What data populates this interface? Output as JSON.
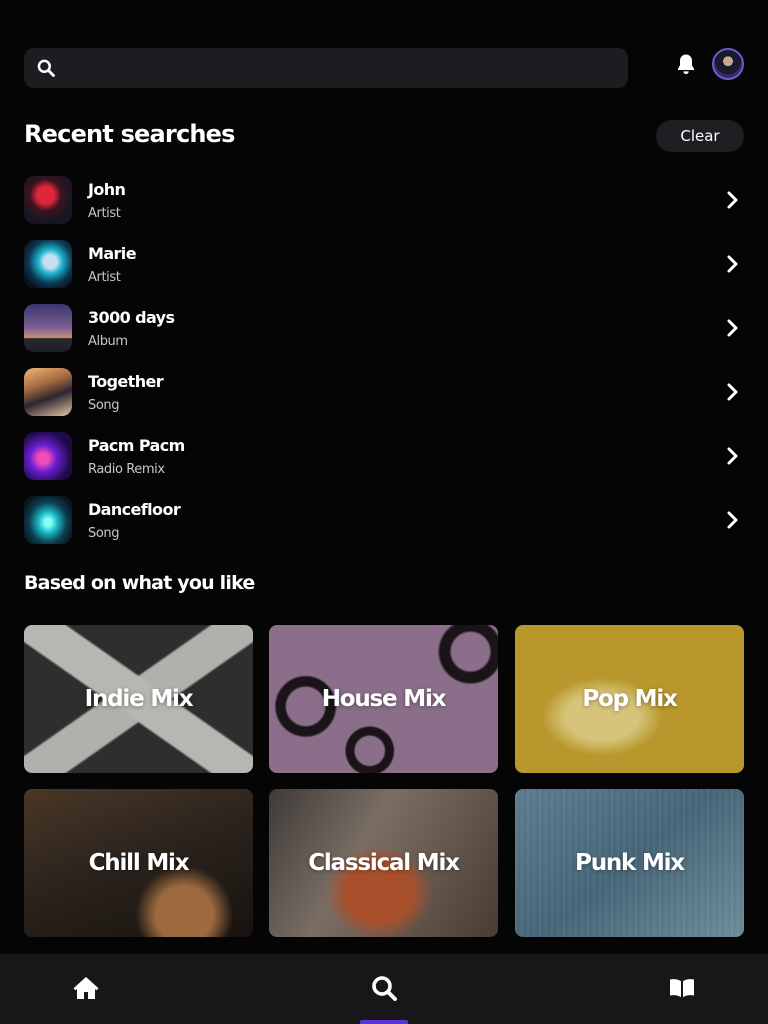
{
  "header": {
    "search_placeholder": "",
    "search_value": ""
  },
  "recent": {
    "title": "Recent searches",
    "clear_label": "Clear",
    "items": [
      {
        "name": "John",
        "type": "Artist"
      },
      {
        "name": "Marie",
        "type": "Artist"
      },
      {
        "name": "3000 days",
        "type": "Album"
      },
      {
        "name": "Together",
        "type": "Song"
      },
      {
        "name": "Pacm Pacm",
        "type": "Radio Remix"
      },
      {
        "name": "Dancefloor",
        "type": "Song"
      }
    ]
  },
  "suggestions": {
    "title": "Based on what you like",
    "mixes": [
      {
        "label": "Indie Mix"
      },
      {
        "label": "House Mix"
      },
      {
        "label": "Pop Mix"
      },
      {
        "label": "Chill Mix"
      },
      {
        "label": "Classical Mix"
      },
      {
        "label": "Punk Mix"
      }
    ]
  },
  "nav": {
    "items": [
      "home-icon",
      "search-icon",
      "library-icon"
    ],
    "active": "search"
  },
  "colors": {
    "background": "#050506",
    "surface": "#1d1d21",
    "accent": "#5b33d6",
    "text_secondary": "#c7c7cc"
  }
}
